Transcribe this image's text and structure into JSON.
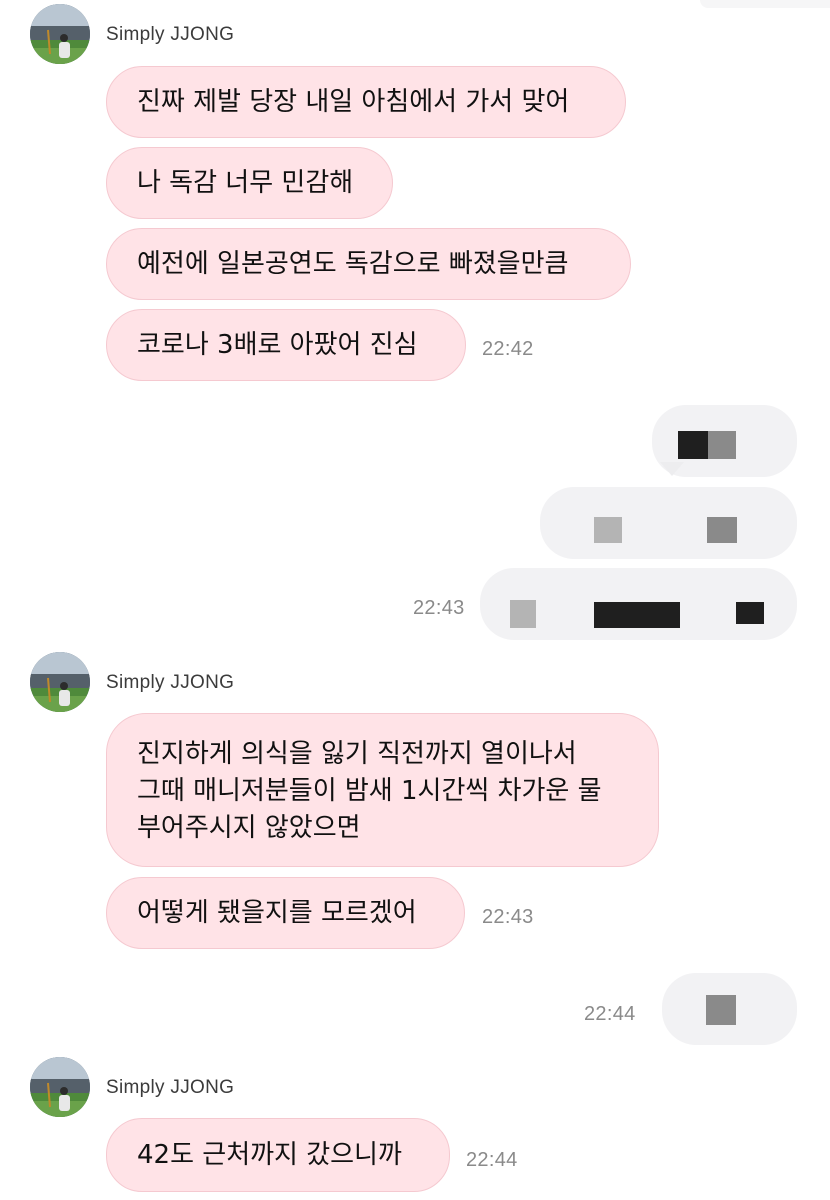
{
  "chat": {
    "sender_name": "Simply JJONG",
    "groups": [
      {
        "messages": [
          "진짜 제발 당장 내일 아침에서 가서 맞어",
          "나 독감 너무 민감해",
          "예전에 일본공연도 독감으로 빠졌을만큼",
          "코로나 3배로 아팠어 진심"
        ],
        "time": "22:42"
      },
      {
        "messages": [
          [
            "진지하게 의식을 잃기 직전까지 열이나서",
            "그때 매니저분들이 밤새 1시간씩 차가운 물",
            "부어주시지 않았으면"
          ],
          "어떻게 됐을지를 모르겠어"
        ],
        "time": "22:43"
      },
      {
        "messages": [
          "42도 근처까지 갔으니까"
        ],
        "time": "22:44"
      }
    ],
    "outgoing": [
      {
        "time": "22:43",
        "censored": true
      },
      {
        "time": "22:44",
        "censored": true
      }
    ]
  }
}
